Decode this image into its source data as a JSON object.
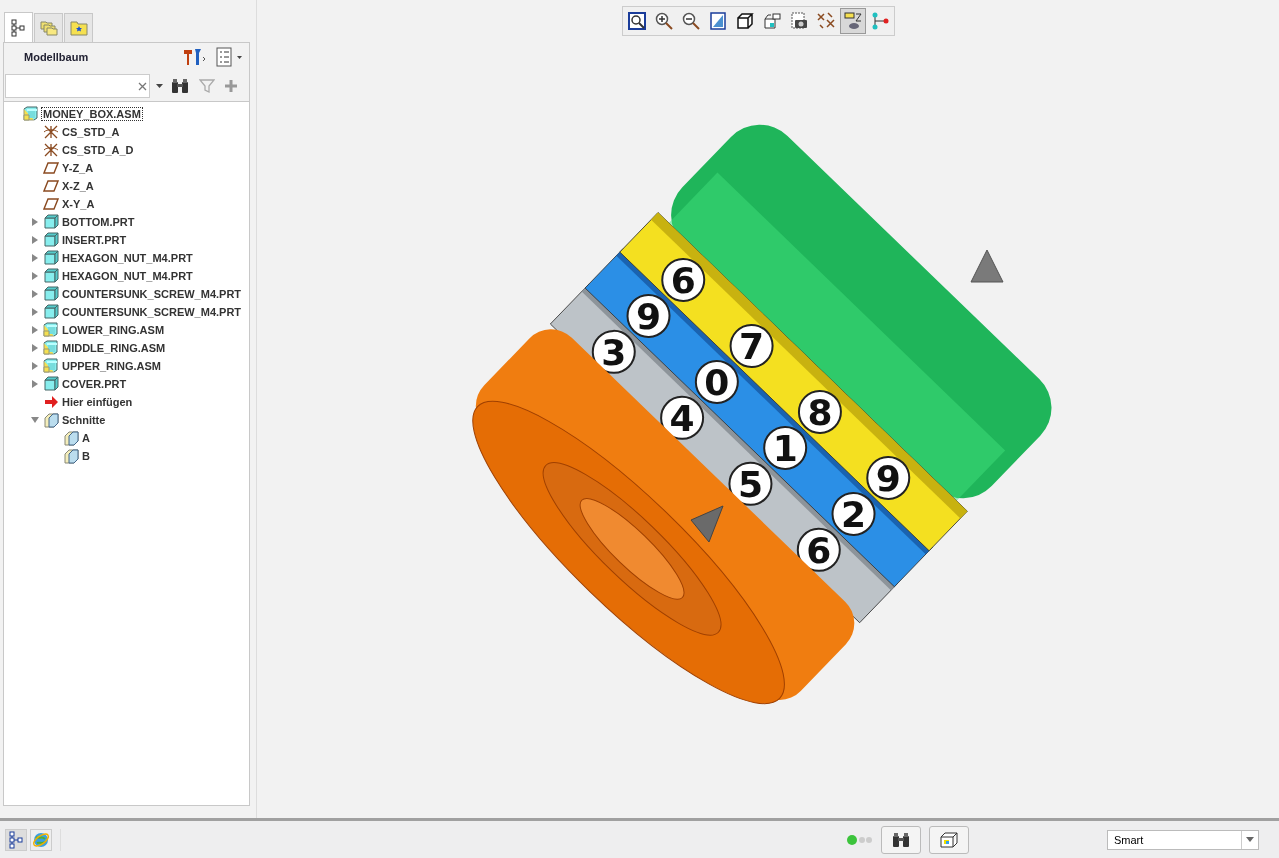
{
  "panel_tabs": [
    {
      "kind": "tree",
      "selected": true
    },
    {
      "kind": "folders",
      "selected": false
    },
    {
      "kind": "favorites",
      "selected": false
    }
  ],
  "model_tree": {
    "title": "Modellbaum",
    "items": [
      {
        "label": "MONEY_BOX.ASM",
        "kind": "assembly",
        "selected": true,
        "children": [
          {
            "label": "CS_STD_A",
            "kind": "csys"
          },
          {
            "label": "CS_STD_A_D",
            "kind": "csys"
          },
          {
            "label": "Y-Z_A",
            "kind": "plane"
          },
          {
            "label": "X-Z_A",
            "kind": "plane"
          },
          {
            "label": "X-Y_A",
            "kind": "plane"
          },
          {
            "label": "BOTTOM.PRT",
            "kind": "part",
            "expanded": false
          },
          {
            "label": "INSERT.PRT",
            "kind": "part",
            "expanded": false
          },
          {
            "label": "HEXAGON_NUT_M4.PRT",
            "kind": "part",
            "expanded": false
          },
          {
            "label": "HEXAGON_NUT_M4.PRT",
            "kind": "part",
            "expanded": false
          },
          {
            "label": "COUNTERSUNK_SCREW_M4.PRT",
            "kind": "part",
            "expanded": false
          },
          {
            "label": "COUNTERSUNK_SCREW_M4.PRT",
            "kind": "part",
            "expanded": false
          },
          {
            "label": "LOWER_RING.ASM",
            "kind": "assembly",
            "expanded": false
          },
          {
            "label": "MIDDLE_RING.ASM",
            "kind": "assembly",
            "expanded": false
          },
          {
            "label": "UPPER_RING.ASM",
            "kind": "assembly",
            "expanded": false
          },
          {
            "label": "COVER.PRT",
            "kind": "part",
            "expanded": false
          },
          {
            "label": "Hier einfügen",
            "kind": "insert"
          },
          {
            "label": "Schnitte",
            "kind": "sections",
            "expanded": true,
            "children": [
              {
                "label": "A",
                "kind": "section"
              },
              {
                "label": "B",
                "kind": "section"
              }
            ]
          }
        ]
      }
    ]
  },
  "view_toolbar": [
    {
      "kind": "refit",
      "selected": false
    },
    {
      "kind": "zoom-in",
      "selected": false
    },
    {
      "kind": "zoom-out",
      "selected": false
    },
    {
      "kind": "repaint",
      "selected": false
    },
    {
      "kind": "display-style",
      "selected": false
    },
    {
      "kind": "saved-views",
      "selected": false
    },
    {
      "kind": "view-manager",
      "selected": false
    },
    {
      "kind": "datum-display",
      "selected": false
    },
    {
      "kind": "annotation-display",
      "selected": true
    },
    {
      "kind": "connector",
      "selected": false
    }
  ],
  "model_rings": [
    {
      "digits": [
        "3",
        "4",
        "5",
        "6"
      ]
    },
    {
      "digits": [
        "9",
        "0",
        "1",
        "2"
      ]
    },
    {
      "digits": [
        "6",
        "7",
        "8",
        "9"
      ]
    }
  ],
  "status_bar": {
    "filter": "Smart"
  }
}
